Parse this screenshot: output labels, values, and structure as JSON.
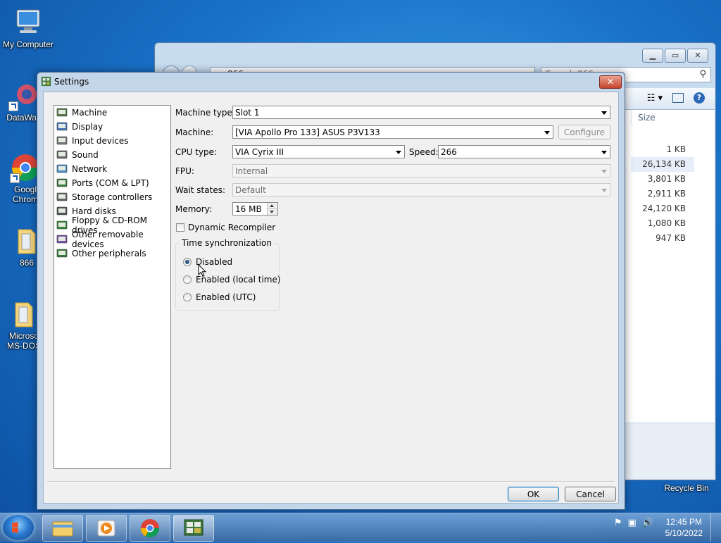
{
  "desktop": {
    "icons": [
      {
        "label": "My Computer"
      },
      {
        "label": "DataWag"
      },
      {
        "label": "Googl",
        "label2": "Chrom"
      },
      {
        "label": "866"
      },
      {
        "label": "Microso",
        "label2": "MS-DOS"
      },
      {
        "label": "Recycle Bin"
      }
    ]
  },
  "explorer": {
    "address_text": "866",
    "search_placeholder": "Search 866",
    "column_size": "Size",
    "sizes": [
      "1 KB",
      "26,134 KB",
      "3,801 KB",
      "2,911 KB",
      "24,120 KB",
      "1,080 KB",
      "947 KB"
    ],
    "selected_row": 1
  },
  "dialog": {
    "title": "Settings",
    "close_label": "✕",
    "tree": [
      {
        "label": "Machine",
        "icon": "machine-icon"
      },
      {
        "label": "Display",
        "icon": "display-icon"
      },
      {
        "label": "Input devices",
        "icon": "input-devices-icon"
      },
      {
        "label": "Sound",
        "icon": "sound-icon"
      },
      {
        "label": "Network",
        "icon": "network-icon"
      },
      {
        "label": "Ports (COM & LPT)",
        "icon": "ports-icon"
      },
      {
        "label": "Storage controllers",
        "icon": "storage-icon"
      },
      {
        "label": "Hard disks",
        "icon": "hard-disk-icon"
      },
      {
        "label": "Floppy & CD-ROM drives",
        "icon": "floppy-cdrom-icon"
      },
      {
        "label": "Other removable devices",
        "icon": "removable-icon"
      },
      {
        "label": "Other peripherals",
        "icon": "peripherals-icon"
      }
    ],
    "machine": {
      "machine_type_label": "Machine type:",
      "machine_type_value": "Slot 1",
      "machine_label": "Machine:",
      "machine_value": "[VIA Apollo Pro 133] ASUS P3V133",
      "configure_label": "Configure",
      "cpu_type_label": "CPU type:",
      "cpu_type_value": "VIA Cyrix III",
      "speed_label": "Speed:",
      "speed_value": "266",
      "fpu_label": "FPU:",
      "fpu_value": "Internal",
      "wait_states_label": "Wait states:",
      "wait_states_value": "Default",
      "memory_label": "Memory:",
      "memory_value": "16 MB",
      "dynarec_label": "Dynamic Recompiler",
      "dynarec_checked": false,
      "time_sync_title": "Time synchronization",
      "time_sync_options": [
        "Disabled",
        "Enabled (local time)",
        "Enabled (UTC)"
      ],
      "time_sync_selected": 0
    },
    "ok_label": "OK",
    "cancel_label": "Cancel"
  },
  "taskbar": {
    "time": "12:45 PM",
    "date": "5/10/2022"
  },
  "colors": {
    "desktop": "#1a73c9",
    "dialog_frame": "#c4d6ea",
    "close_button": "#c6452e"
  }
}
